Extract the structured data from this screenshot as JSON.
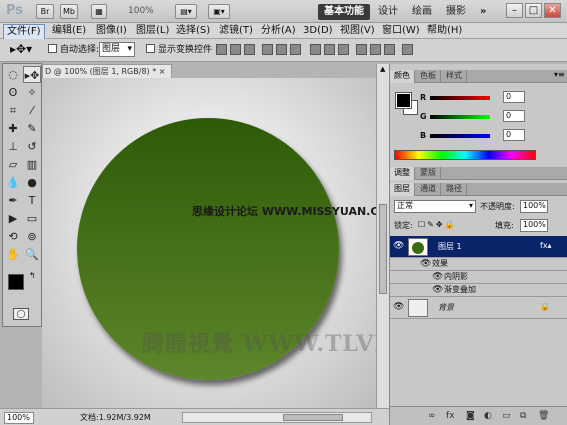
{
  "titlebar": {
    "app_logo": "Ps",
    "buttons": [
      "Br",
      "Mb"
    ],
    "zoom": "100%",
    "workspaces": [
      "基本功能",
      "设计",
      "绘画",
      "摄影"
    ],
    "more": "»",
    "window_controls": [
      "–",
      "□",
      "✕"
    ]
  },
  "menubar": {
    "items": [
      "文件(F)",
      "编辑(E)",
      "图像(I)",
      "图层(L)",
      "选择(S)",
      "滤镜(T)",
      "分析(A)",
      "3D(D)",
      "视图(V)",
      "窗口(W)",
      "帮助(H)"
    ]
  },
  "options": {
    "auto_select_label": "自动选择:",
    "auto_select_value": "图层",
    "show_transform_label": "显示变换控件"
  },
  "document": {
    "tab_title": "D @ 100% (图层 1, RGB/8) *",
    "close": "×",
    "watermark_top": "思缘设计论坛  WWW.MISSYUAN.COM",
    "watermark_bottom": "腾龍視覺  WWW.TLVI.NET"
  },
  "status": {
    "zoom": "100%",
    "doc_info": "文档:1.92M/3.92M"
  },
  "color_panel": {
    "tabs": [
      "颜色",
      "色板",
      "样式"
    ],
    "r_label": "R",
    "g_label": "G",
    "b_label": "B",
    "r_value": "0",
    "g_value": "0",
    "b_value": "0"
  },
  "adjust_panel": {
    "tabs": [
      "调整",
      "蒙版"
    ]
  },
  "layers_panel": {
    "tabs": [
      "图层",
      "通道",
      "路径"
    ],
    "blend_mode": "正常",
    "opacity_label": "不透明度:",
    "opacity_value": "100%",
    "lock_label": "锁定:",
    "fill_label": "填充:",
    "fill_value": "100%",
    "layers": [
      {
        "name": "图层 1",
        "selected": true
      },
      {
        "name": "背景",
        "selected": false
      }
    ],
    "effects_label": "效果",
    "effects": [
      "内阴影",
      "渐变叠加"
    ],
    "footer_icons": [
      "link-icon",
      "fx-icon",
      "mask-icon",
      "adjustment-icon",
      "group-icon",
      "new-layer-icon",
      "trash-icon"
    ]
  },
  "colors": {
    "circle_top": "#2e5a08",
    "circle_bottom": "#5e862a",
    "selected_layer": "#0a246a",
    "workspace_active": "#3a3a3a"
  }
}
